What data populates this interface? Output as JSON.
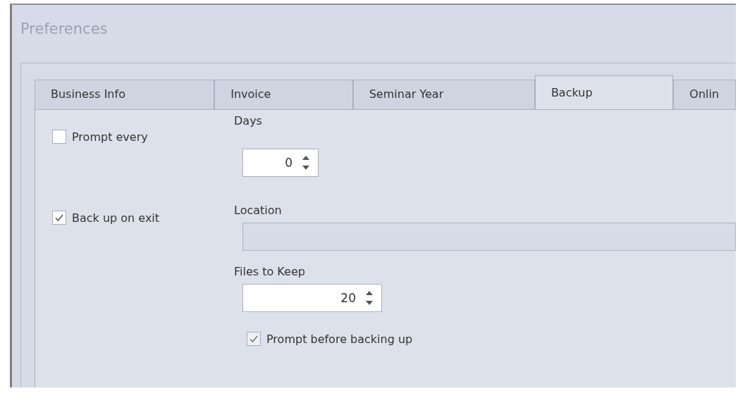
{
  "window": {
    "title": "Preferences"
  },
  "tabs": [
    {
      "label": "Business Info",
      "selected": false
    },
    {
      "label": "Invoice",
      "selected": false
    },
    {
      "label": "Seminar Year",
      "selected": false
    },
    {
      "label": "Backup",
      "selected": true
    },
    {
      "label": "Onlin",
      "selected": false
    }
  ],
  "options": [
    {
      "label": "Prompt every",
      "checked": false
    },
    {
      "label": "Back up on exit",
      "checked": true
    }
  ],
  "fields": [
    {
      "kind": "spinner",
      "label": "Days",
      "value": "0"
    },
    {
      "kind": "text",
      "label": "Location"
    },
    {
      "kind": "spinner",
      "label": "Files to Keep",
      "value": "20"
    }
  ],
  "prompt_before": {
    "label": "Prompt before backing up",
    "checked": true
  }
}
